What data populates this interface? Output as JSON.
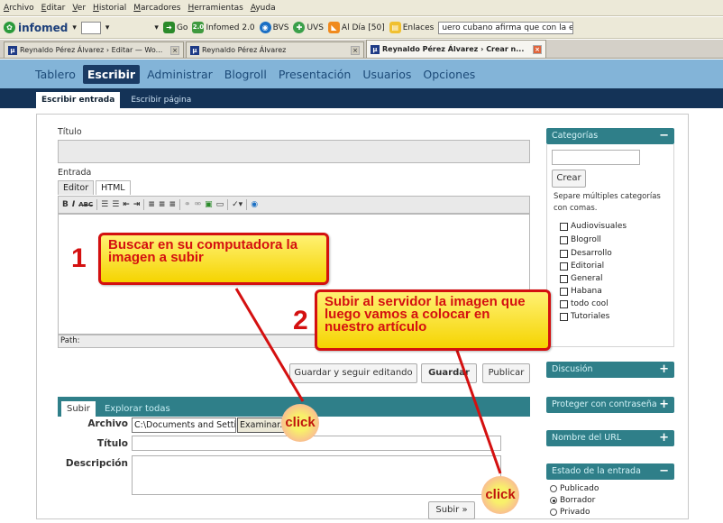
{
  "browser": {
    "menu": [
      "Archivo",
      "Editar",
      "Ver",
      "Historial",
      "Marcadores",
      "Herramientas",
      "Ayuda"
    ],
    "toolbar": {
      "brand": "infomed",
      "go_label": "Go",
      "infomed20_label": "Infomed 2.0",
      "bvs_label": "BVS",
      "uvs_label": "UVS",
      "aldia_label": "Al Día [50]",
      "enlaces_label": "Enlaces",
      "search_text": "uero cubano afirma que con la edad mejo"
    },
    "tabs": [
      {
        "label": "Reynaldo Pérez Álvarez › Editar — Wo...",
        "active": false
      },
      {
        "label": "Reynaldo Pérez Álvarez",
        "active": false
      },
      {
        "label": "Reynaldo Pérez Álvarez › Crear n...",
        "active": true
      }
    ]
  },
  "admin": {
    "nav": [
      "Tablero",
      "Escribir",
      "Administrar",
      "Blogroll",
      "Presentación",
      "Usuarios",
      "Opciones"
    ],
    "subnav": [
      "Escribir entrada",
      "Escribir página"
    ]
  },
  "form": {
    "title_label": "Título",
    "entry_label": "Entrada",
    "editor_tab": "Editor",
    "html_tab": "HTML",
    "path_label": "Path:",
    "save_continue": "Guardar y seguir editando",
    "save": "Guardar",
    "publish": "Publicar"
  },
  "upload": {
    "tab_upload": "Subir",
    "tab_browse_all": "Explorar todas",
    "file_label": "Archivo",
    "file_value": "C:\\Documents and Settir",
    "browse_button": "Examinar...",
    "title_label": "Título",
    "description_label": "Descripción",
    "upload_button": "Subir »"
  },
  "sidebar": {
    "categories_title": "Categorías",
    "create_button": "Crear",
    "help_text_1": "Separe múltiples categorías",
    "help_text_2": "con comas.",
    "categories": [
      "Audiovisuales",
      "Blogroll",
      "Desarrollo",
      "Editorial",
      "General",
      "Habana",
      "todo cool",
      "Tutoriales"
    ],
    "discussion_title": "Discusión",
    "password_title": "Proteger con contraseña",
    "url_title": "Nombre del URL",
    "status_title": "Estado de la entrada",
    "status_options": [
      {
        "label": "Publicado",
        "checked": false
      },
      {
        "label": "Borrador",
        "checked": true
      },
      {
        "label": "Privado",
        "checked": false
      }
    ]
  },
  "annotations": {
    "step1_number": "1",
    "step1_text": "Buscar en su computadora la imagen a subir",
    "step2_number": "2",
    "step2_text": "Subir al servidor la imagen que luego vamos a colocar en nuestro artículo",
    "click_label": "click"
  },
  "colors": {
    "admin_nav_bg": "#83b4d8",
    "admin_subnav_bg": "#143357",
    "sidebar_head_bg": "#2f7f89",
    "annotation_red": "#d41010",
    "annotation_yellow": "#f5d400"
  }
}
